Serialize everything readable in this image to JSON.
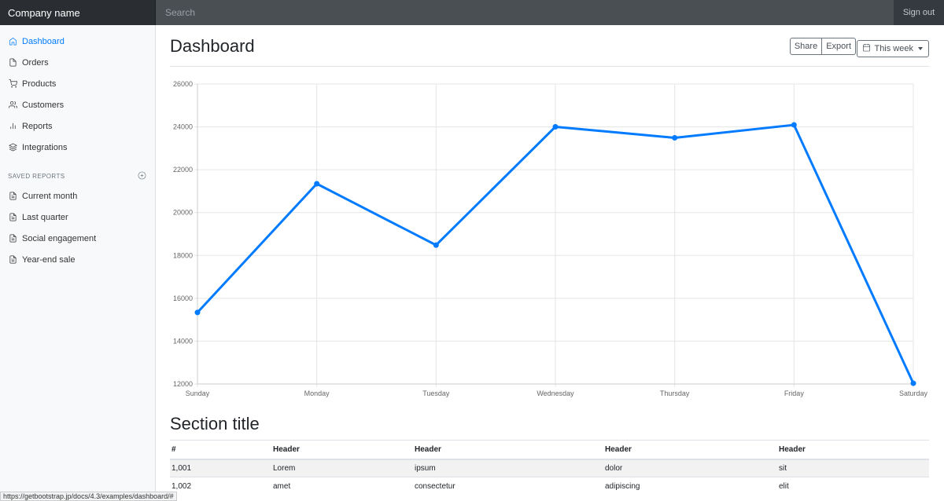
{
  "navbar": {
    "brand": "Company name",
    "search_placeholder": "Search",
    "signout": "Sign out"
  },
  "sidebar": {
    "items": [
      {
        "label": "Dashboard",
        "icon": "home-icon",
        "active": true
      },
      {
        "label": "Orders",
        "icon": "file-icon"
      },
      {
        "label": "Products",
        "icon": "shopping-cart-icon"
      },
      {
        "label": "Customers",
        "icon": "users-icon"
      },
      {
        "label": "Reports",
        "icon": "bar-chart-icon"
      },
      {
        "label": "Integrations",
        "icon": "layers-icon"
      }
    ],
    "saved_heading": "SAVED REPORTS",
    "saved": [
      {
        "label": "Current month",
        "icon": "file-text-icon"
      },
      {
        "label": "Last quarter",
        "icon": "file-text-icon"
      },
      {
        "label": "Social engagement",
        "icon": "file-text-icon"
      },
      {
        "label": "Year-end sale",
        "icon": "file-text-icon"
      }
    ]
  },
  "main": {
    "title": "Dashboard",
    "share": "Share",
    "export": "Export",
    "range": "This week",
    "section_title": "Section title"
  },
  "chart_data": {
    "type": "line",
    "categories": [
      "Sunday",
      "Monday",
      "Tuesday",
      "Wednesday",
      "Thursday",
      "Friday",
      "Saturday"
    ],
    "values": [
      15339,
      21345,
      18483,
      24003,
      23489,
      24092,
      12034
    ],
    "ylim": [
      12000,
      26000
    ],
    "yticks": [
      "26000",
      "24000",
      "22000",
      "20000",
      "18000",
      "16000",
      "14000",
      "12000"
    ],
    "color": "#007bff",
    "grid": true
  },
  "table": {
    "headers": [
      "#",
      "Header",
      "Header",
      "Header",
      "Header"
    ],
    "rows": [
      [
        "1,001",
        "Lorem",
        "ipsum",
        "dolor",
        "sit"
      ],
      [
        "1,002",
        "amet",
        "consectetur",
        "adipiscing",
        "elit"
      ]
    ]
  },
  "status_url": "https://getbootstrap.jp/docs/4.3/examples/dashboard/#"
}
